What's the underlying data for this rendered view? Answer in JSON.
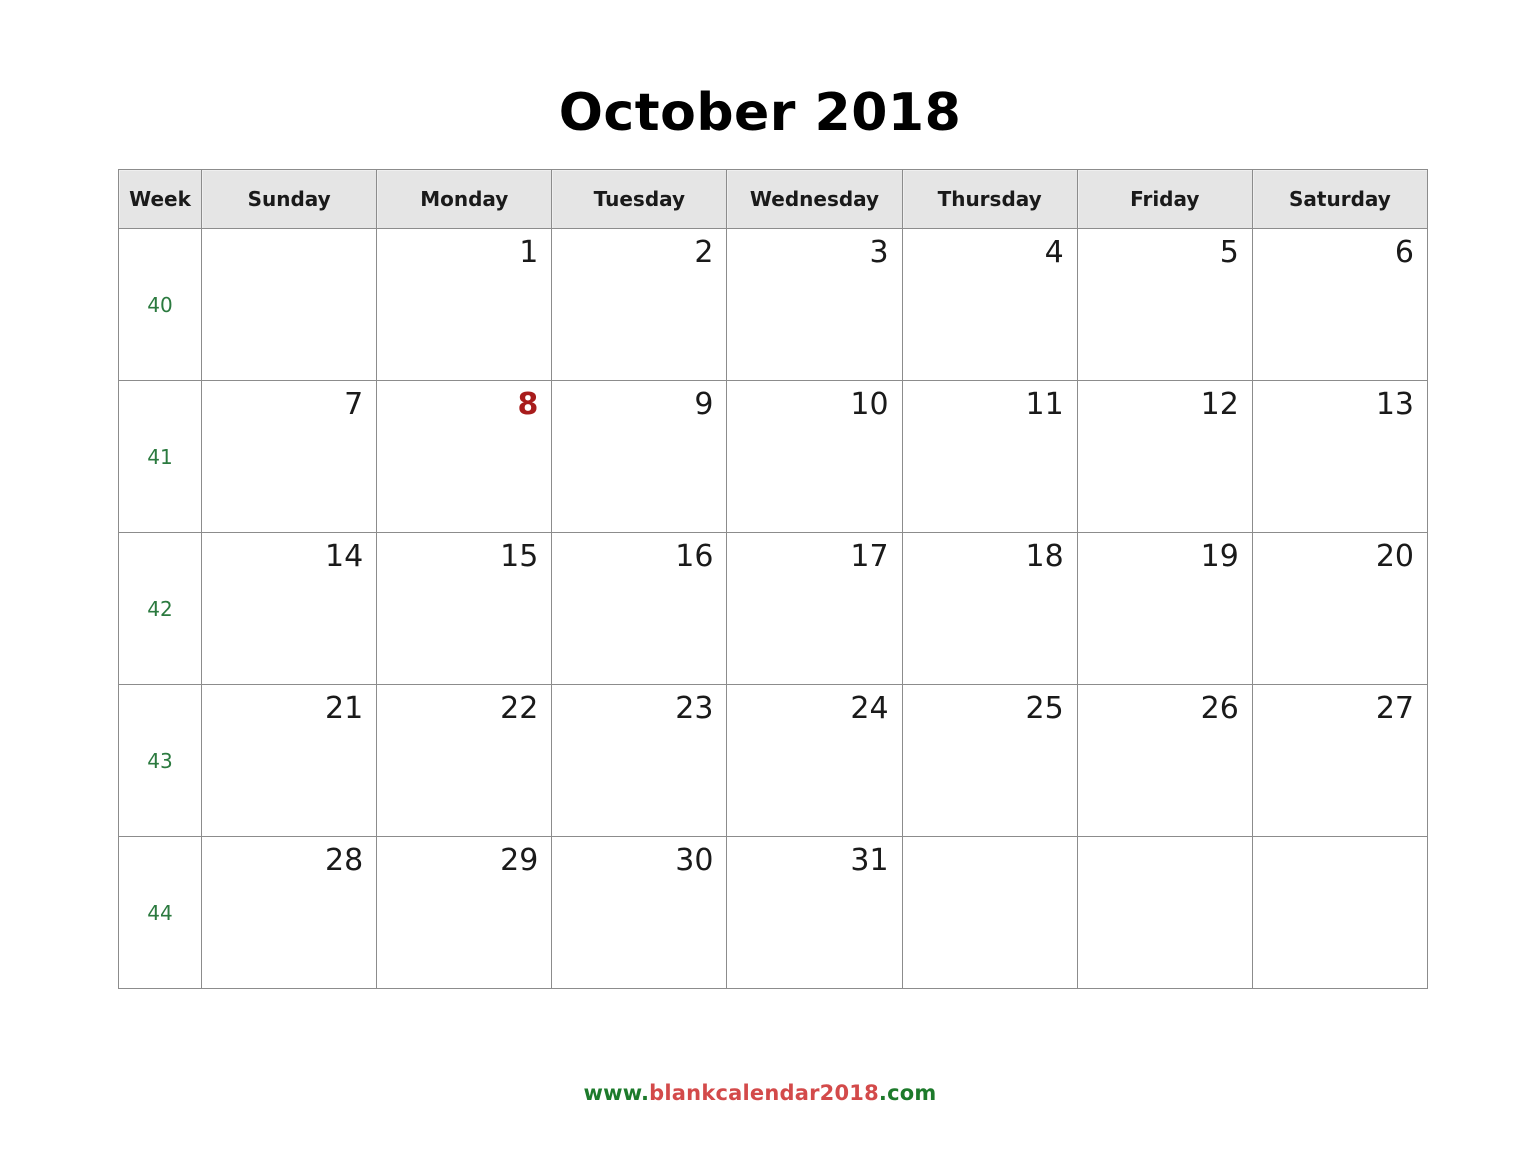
{
  "title": "October 2018",
  "colors": {
    "header_bg": "#e5e5e5",
    "grid_line": "#8c8c8c",
    "week_number": "#2b7a3f",
    "highlight_day": "#a81c1c",
    "footer_green": "#1d7a2b",
    "footer_red": "#d34a4a"
  },
  "headers": {
    "week": "Week",
    "days": [
      "Sunday",
      "Monday",
      "Tuesday",
      "Wednesday",
      "Thursday",
      "Friday",
      "Saturday"
    ]
  },
  "weeks": [
    {
      "number": "40",
      "days": [
        {
          "label": "",
          "highlight": false
        },
        {
          "label": "1",
          "highlight": false
        },
        {
          "label": "2",
          "highlight": false
        },
        {
          "label": "3",
          "highlight": false
        },
        {
          "label": "4",
          "highlight": false
        },
        {
          "label": "5",
          "highlight": false
        },
        {
          "label": "6",
          "highlight": false
        }
      ]
    },
    {
      "number": "41",
      "days": [
        {
          "label": "7",
          "highlight": false
        },
        {
          "label": "8",
          "highlight": true
        },
        {
          "label": "9",
          "highlight": false
        },
        {
          "label": "10",
          "highlight": false
        },
        {
          "label": "11",
          "highlight": false
        },
        {
          "label": "12",
          "highlight": false
        },
        {
          "label": "13",
          "highlight": false
        }
      ]
    },
    {
      "number": "42",
      "days": [
        {
          "label": "14",
          "highlight": false
        },
        {
          "label": "15",
          "highlight": false
        },
        {
          "label": "16",
          "highlight": false
        },
        {
          "label": "17",
          "highlight": false
        },
        {
          "label": "18",
          "highlight": false
        },
        {
          "label": "19",
          "highlight": false
        },
        {
          "label": "20",
          "highlight": false
        }
      ]
    },
    {
      "number": "43",
      "days": [
        {
          "label": "21",
          "highlight": false
        },
        {
          "label": "22",
          "highlight": false
        },
        {
          "label": "23",
          "highlight": false
        },
        {
          "label": "24",
          "highlight": false
        },
        {
          "label": "25",
          "highlight": false
        },
        {
          "label": "26",
          "highlight": false
        },
        {
          "label": "27",
          "highlight": false
        }
      ]
    },
    {
      "number": "44",
      "days": [
        {
          "label": "28",
          "highlight": false
        },
        {
          "label": "29",
          "highlight": false
        },
        {
          "label": "30",
          "highlight": false
        },
        {
          "label": "31",
          "highlight": false
        },
        {
          "label": "",
          "highlight": false
        },
        {
          "label": "",
          "highlight": false
        },
        {
          "label": "",
          "highlight": false
        }
      ]
    }
  ],
  "footer": {
    "part1": "www.",
    "part2": "blankcalendar2018",
    "part3": ".com"
  }
}
